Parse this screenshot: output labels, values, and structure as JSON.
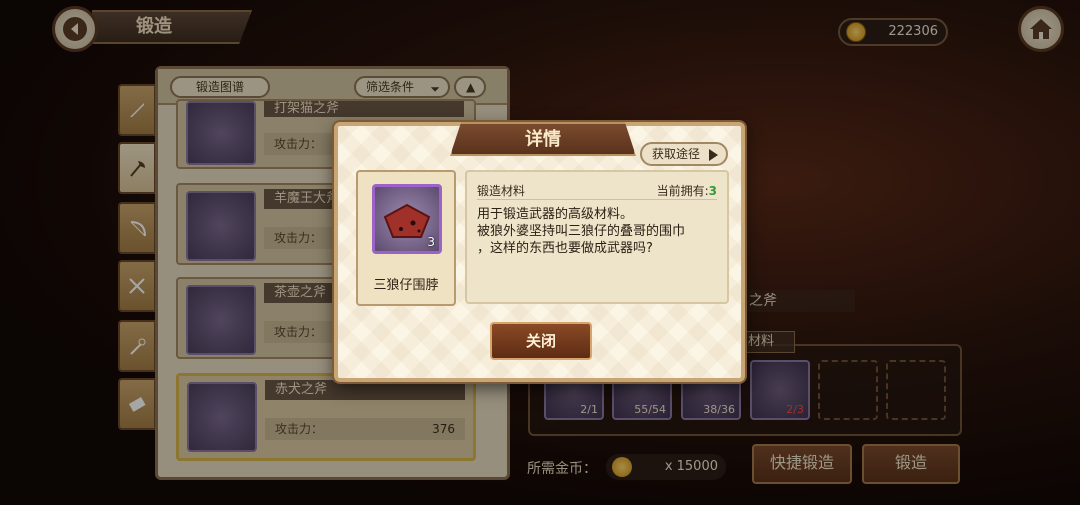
{
  "header": {
    "title": "锻造",
    "gold": "222306"
  },
  "side_tabs": [
    "sword-icon",
    "axe-icon",
    "bow-icon",
    "cross-icon",
    "staff-icon",
    "scroll-icon"
  ],
  "list": {
    "atlas_label": "锻造图谱",
    "filter_label": "筛选条件",
    "items": [
      {
        "name": "打架猫之斧",
        "atk_label": "攻击力：",
        "atk": ""
      },
      {
        "name": "羊魔王大斧",
        "atk_label": "攻击力：",
        "atk": ""
      },
      {
        "name": "茶壶之斧",
        "atk_label": "攻击力：",
        "atk": ""
      },
      {
        "name": "赤犬之斧",
        "atk_label": "攻击力：",
        "atk": "376"
      }
    ]
  },
  "forge": {
    "item_name": "之斧",
    "materials_label": "材料",
    "materials": [
      {
        "count": "2/1",
        "ok": true
      },
      {
        "count": "55/54",
        "ok": true
      },
      {
        "count": "38/36",
        "ok": true
      },
      {
        "count": "2/3",
        "ok": false
      }
    ],
    "cost_label": "所需金币：",
    "cost_value": "x 15000",
    "quick_forge": "快捷锻造",
    "forge_btn": "锻造"
  },
  "modal": {
    "title": "详情",
    "get_path": "获取途径",
    "item_name": "三狼仔围脖",
    "item_count": "3",
    "section_label": "锻造材料",
    "owned_label": "当前拥有:",
    "owned_value": "3",
    "desc_line1": "用于锻造武器的高级材料。",
    "desc_line2": "被狼外婆坚持叫三狼仔的叠哥的围巾",
    "desc_line3": "，这样的东西也要做成武器吗?",
    "close": "关闭"
  }
}
